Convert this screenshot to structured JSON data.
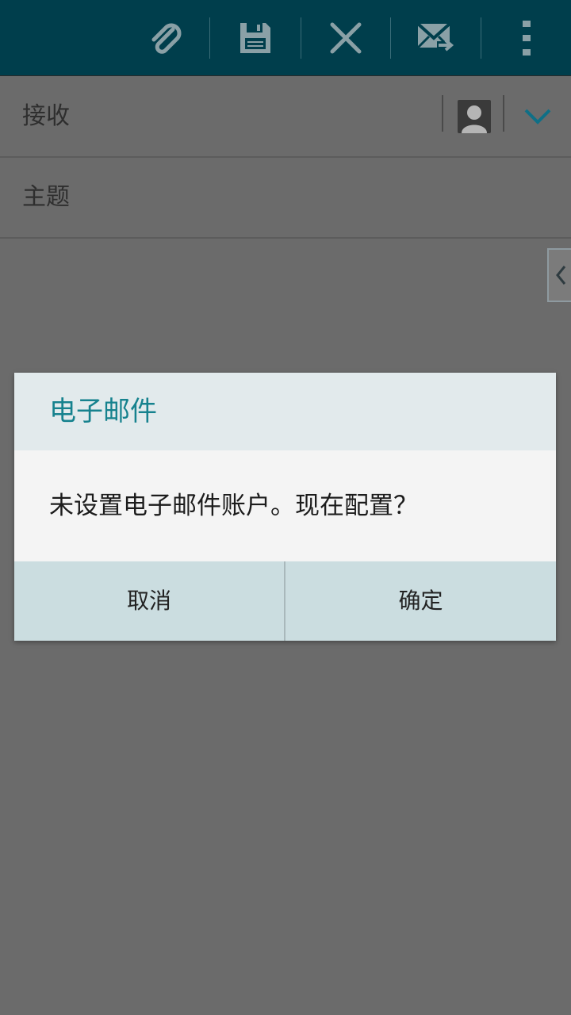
{
  "toolbar": {
    "icons": [
      "attach-icon",
      "save-icon",
      "close-icon",
      "send-icon",
      "overflow-menu-icon"
    ]
  },
  "compose": {
    "to_label": "接收",
    "subject_label": "主题"
  },
  "dialog": {
    "title": "电子邮件",
    "message": "未设置电子邮件账户。现在配置？",
    "cancel_label": "取消",
    "ok_label": "确定"
  },
  "colors": {
    "toolbar_bg": "#003e4c",
    "dialog_title": "#16828e",
    "accent": "#0f6f86"
  }
}
